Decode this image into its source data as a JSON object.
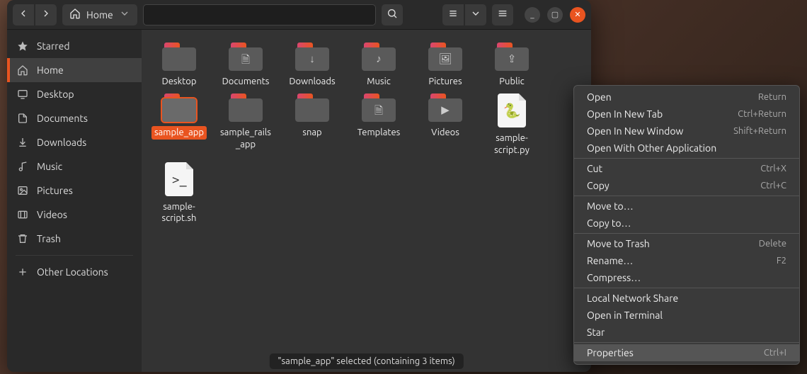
{
  "path": {
    "label": "Home"
  },
  "sidebar": [
    {
      "icon": "star",
      "label": "Starred"
    },
    {
      "icon": "home",
      "label": "Home",
      "selected": true
    },
    {
      "icon": "desktop",
      "label": "Desktop"
    },
    {
      "icon": "doc",
      "label": "Documents"
    },
    {
      "icon": "down",
      "label": "Downloads"
    },
    {
      "icon": "music",
      "label": "Music"
    },
    {
      "icon": "pic",
      "label": "Pictures"
    },
    {
      "icon": "video",
      "label": "Videos"
    },
    {
      "icon": "trash",
      "label": "Trash"
    },
    {
      "sep": true
    },
    {
      "icon": "plus",
      "label": "Other Locations"
    }
  ],
  "files": [
    {
      "type": "folder",
      "glyph": "",
      "label": "Desktop"
    },
    {
      "type": "folder",
      "glyph": "🗎",
      "label": "Documents"
    },
    {
      "type": "folder",
      "glyph": "↓",
      "label": "Downloads"
    },
    {
      "type": "folder",
      "glyph": "♪",
      "label": "Music"
    },
    {
      "type": "folder",
      "glyph": "🖼",
      "label": "Pictures"
    },
    {
      "type": "folder",
      "glyph": "⇪",
      "label": "Public"
    },
    {
      "type": "folder",
      "glyph": "",
      "label": "sample_app",
      "selected": true
    },
    {
      "type": "folder",
      "glyph": "",
      "label": "sample_rails_app"
    },
    {
      "type": "folder",
      "glyph": "",
      "label": "snap"
    },
    {
      "type": "folder",
      "glyph": "🗎",
      "label": "Templates"
    },
    {
      "type": "folder",
      "glyph": "▶",
      "label": "Videos"
    },
    {
      "type": "doc",
      "glyph": "🐍",
      "label": "sample-script.py"
    },
    {
      "type": "doc",
      "glyph": ">_",
      "label": "sample-script.sh"
    }
  ],
  "statusbar": "\"sample_app\" selected  (containing 3 items)",
  "context_menu": [
    {
      "label": "Open",
      "accel": "Return"
    },
    {
      "label": "Open In New Tab",
      "accel": "Ctrl+Return"
    },
    {
      "label": "Open In New Window",
      "accel": "Shift+Return"
    },
    {
      "label": "Open With Other Application"
    },
    {
      "sep": true
    },
    {
      "label": "Cut",
      "accel": "Ctrl+X"
    },
    {
      "label": "Copy",
      "accel": "Ctrl+C"
    },
    {
      "sep": true
    },
    {
      "label": "Move to…"
    },
    {
      "label": "Copy to…"
    },
    {
      "sep": true
    },
    {
      "label": "Move to Trash",
      "accel": "Delete"
    },
    {
      "label": "Rename…",
      "accel": "F2"
    },
    {
      "label": "Compress…"
    },
    {
      "sep": true
    },
    {
      "label": "Local Network Share"
    },
    {
      "label": "Open in Terminal"
    },
    {
      "label": "Star"
    },
    {
      "sep": true
    },
    {
      "label": "Properties",
      "accel": "Ctrl+I",
      "hovered": true
    }
  ]
}
